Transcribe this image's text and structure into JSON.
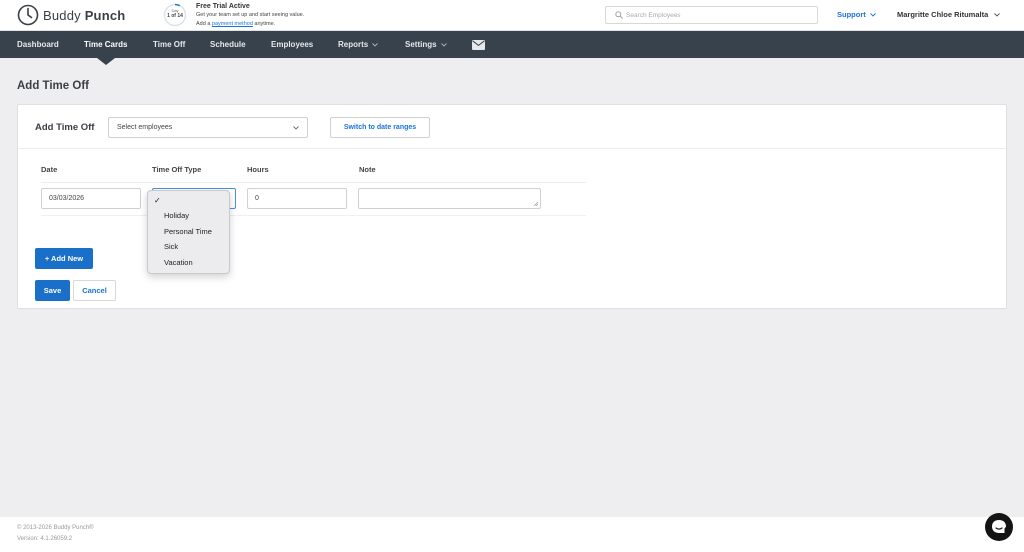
{
  "header": {
    "logo_text_light": "Buddy",
    "logo_text_bold": "Punch",
    "trial": {
      "day_label": "Day",
      "day_count": "1 of 14",
      "title": "Free Trial Active",
      "line1": "Get your team set up and start seeing value.",
      "line2_prefix": "Add a",
      "line2_link": "payment method",
      "line2_suffix": "anytime."
    },
    "search_placeholder": "Search Employees",
    "support_label": "Support",
    "user_name": "Margritte Chloe Ritumalta"
  },
  "nav": {
    "items": [
      {
        "label": "Dashboard"
      },
      {
        "label": "Time Cards"
      },
      {
        "label": "Time Off"
      },
      {
        "label": "Schedule"
      },
      {
        "label": "Employees"
      },
      {
        "label": "Reports"
      },
      {
        "label": "Settings"
      }
    ],
    "active": "Time Cards"
  },
  "page": {
    "title": "Add Time Off",
    "form_label": "Add Time Off",
    "select_employees": "Select employees",
    "switch_button": "Switch to date ranges",
    "columns": {
      "date": "Date",
      "type": "Time Off Type",
      "hours": "Hours",
      "note": "Note"
    },
    "row": {
      "date": "03/03/2026",
      "hours": "0",
      "note": ""
    },
    "add_new": "+ Add New",
    "save": "Save",
    "cancel": "Cancel"
  },
  "dropdown": {
    "check": "✓",
    "options": [
      "Holiday",
      "Personal Time",
      "Sick",
      "Vacation"
    ]
  },
  "footer": {
    "copyright": "© 2013-2026 Buddy Punch®",
    "version": "Version: 4.1.26059.2"
  },
  "colors": {
    "nav_bg": "#38424d",
    "primary": "#1a6fc9",
    "link": "#1a73d9"
  }
}
